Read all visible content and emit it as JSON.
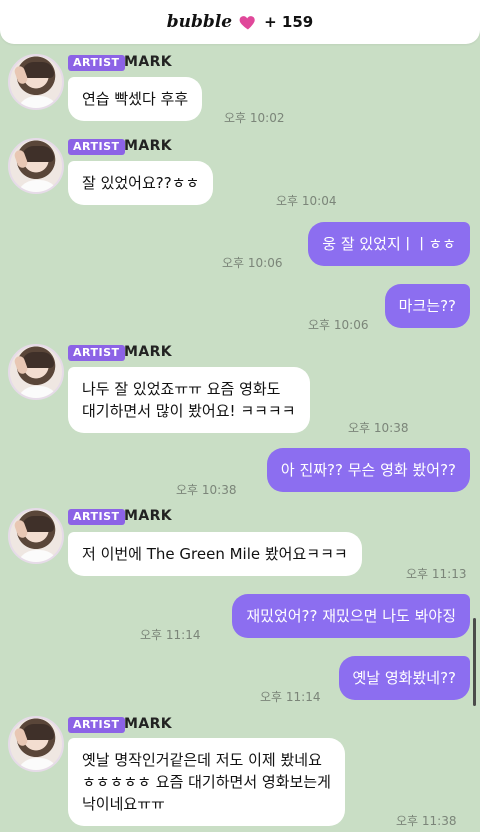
{
  "header": {
    "brand": "bubble",
    "icon": "heart-icon",
    "count_label": "+ 159",
    "accent": "#e0489a"
  },
  "artist": {
    "tag": "ARTIST",
    "name": "MARK",
    "tag_color": "#8c63e6"
  },
  "colors": {
    "background": "#c9dec5",
    "outgoing": "#8c6ef0",
    "incoming": "#ffffff"
  },
  "messages": [
    {
      "from": "artist",
      "text": "연습 빡셌다 후후",
      "time": "오후 10:02"
    },
    {
      "from": "artist",
      "text": "  잘 있었어요??ㅎㅎ",
      "time": "오후 10:04"
    },
    {
      "from": "me",
      "text": "웅 잘 있었지ㅣㅣㅎㅎ",
      "time": "오후 10:06"
    },
    {
      "from": "me",
      "text": "마크는??",
      "time": "오후 10:06"
    },
    {
      "from": "artist",
      "text": "나두 잘 있었죠ㅠㅠ 요즘 영화도\n대기하면서 많이 봤어요! ㅋㅋㅋㅋ",
      "time": "오후 10:38"
    },
    {
      "from": "me",
      "text": "아 진짜?? 무슨 영화 봤어??",
      "time": "오후 10:38"
    },
    {
      "from": "artist",
      "text": "저 이번에 The Green Mile 봤어요ㅋㅋㅋ",
      "time": "오후 11:13"
    },
    {
      "from": "me",
      "text": "재밌었어?? 재밌으면 나도 봐야징",
      "time": "오후 11:14"
    },
    {
      "from": "me",
      "text": "옛날 영화봤네??",
      "time": "오후 11:14"
    },
    {
      "from": "artist",
      "text": "옛날 명작인거같은데 저도 이제 봤네요\nㅎㅎㅎㅎㅎ 요즘 대기하면서 영화보는게\n낙이네요ㅠㅠ",
      "time": "오후 11:38"
    }
  ]
}
